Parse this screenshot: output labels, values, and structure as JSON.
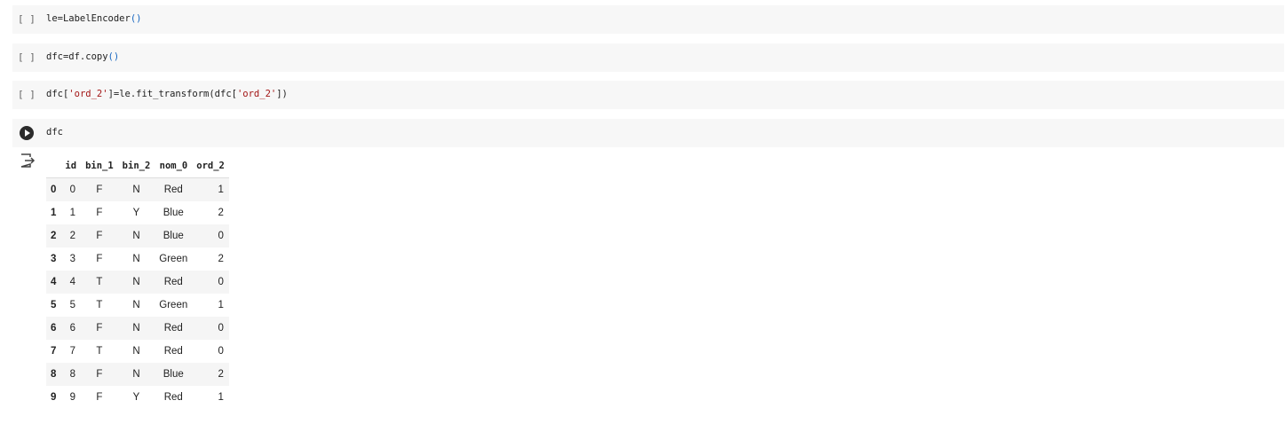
{
  "cells": [
    {
      "exec_count": "[ ]",
      "code": [
        {
          "text": "le=LabelEncoder",
          "kind": "plain"
        },
        {
          "text": "()",
          "kind": "paren"
        }
      ]
    },
    {
      "exec_count": "[ ]",
      "code": [
        {
          "text": "dfc=df.copy",
          "kind": "plain"
        },
        {
          "text": "()",
          "kind": "paren"
        }
      ]
    },
    {
      "exec_count": "[ ]",
      "code": [
        {
          "text": "dfc[",
          "kind": "plain"
        },
        {
          "text": "'ord_2'",
          "kind": "str"
        },
        {
          "text": "]=le.fit_transform(dfc[",
          "kind": "plain"
        },
        {
          "text": "'ord_2'",
          "kind": "str"
        },
        {
          "text": "])",
          "kind": "plain"
        }
      ]
    },
    {
      "code": [
        {
          "text": "dfc",
          "kind": "plain"
        }
      ]
    }
  ],
  "icons": {
    "run": "play-circle-icon",
    "output": "output-redirect-icon"
  },
  "colors": {
    "cell_bg": "#f7f7f7",
    "string": "#a31515",
    "paren": "#1565c0"
  },
  "dataframe": {
    "columns": [
      "",
      "id",
      "bin_1",
      "bin_2",
      "nom_0",
      "ord_2"
    ],
    "rows": [
      [
        "0",
        "0",
        "F",
        "N",
        "Red",
        "1"
      ],
      [
        "1",
        "1",
        "F",
        "Y",
        "Blue",
        "2"
      ],
      [
        "2",
        "2",
        "F",
        "N",
        "Blue",
        "0"
      ],
      [
        "3",
        "3",
        "F",
        "N",
        "Green",
        "2"
      ],
      [
        "4",
        "4",
        "T",
        "N",
        "Red",
        "0"
      ],
      [
        "5",
        "5",
        "T",
        "N",
        "Green",
        "1"
      ],
      [
        "6",
        "6",
        "F",
        "N",
        "Red",
        "0"
      ],
      [
        "7",
        "7",
        "T",
        "N",
        "Red",
        "0"
      ],
      [
        "8",
        "8",
        "F",
        "N",
        "Blue",
        "2"
      ],
      [
        "9",
        "9",
        "F",
        "Y",
        "Red",
        "1"
      ]
    ]
  }
}
